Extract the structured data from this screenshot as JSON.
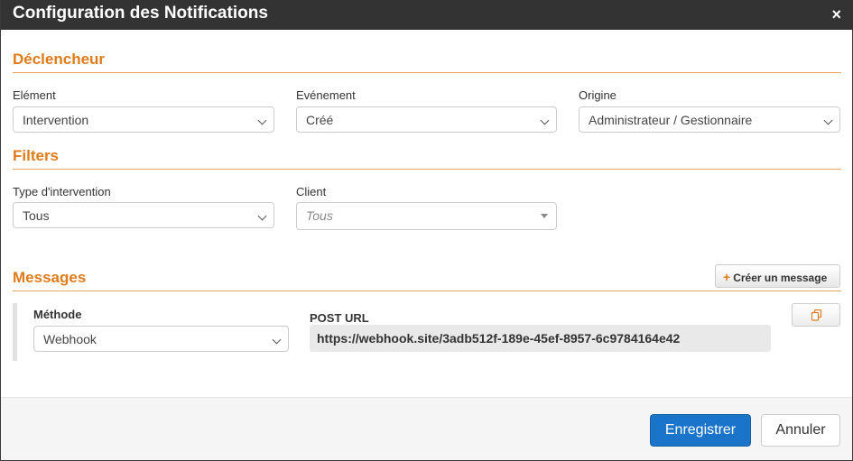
{
  "modal": {
    "title": "Configuration des Notifications",
    "close_icon": "×"
  },
  "trigger": {
    "section_title": "Déclencheur",
    "element": {
      "label": "Elément",
      "value": "Intervention"
    },
    "event": {
      "label": "Evénement",
      "value": "Créé"
    },
    "origin": {
      "label": "Origine",
      "value": "Administrateur / Gestionnaire"
    }
  },
  "filters": {
    "section_title": "Filters",
    "intervention_type": {
      "label": "Type d'intervention",
      "value": "Tous"
    },
    "client": {
      "label": "Client",
      "placeholder": "Tous"
    }
  },
  "messages": {
    "section_title": "Messages",
    "create_button": "Créer un message",
    "create_icon": "+",
    "items": [
      {
        "method_label": "Méthode",
        "method_value": "Webhook",
        "url_label": "POST URL",
        "url_value": "https://webhook.site/3adb512f-189e-45ef-8957-6c9784164e42"
      }
    ]
  },
  "footer": {
    "save_label": "Enregistrer",
    "cancel_label": "Annuler"
  },
  "colors": {
    "accent": "#e07b1a",
    "primary": "#1a74c9",
    "titlebar": "#333333"
  }
}
